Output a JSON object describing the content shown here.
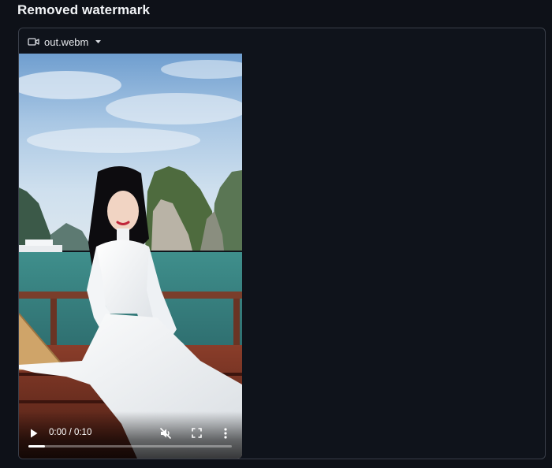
{
  "section": {
    "title": "Removed watermark"
  },
  "file_selector": {
    "filename": "out.webm",
    "icon": "video-camera-icon",
    "dropdown_icon": "caret-down-icon"
  },
  "player": {
    "time_display": "0:00 / 0:10",
    "progress": 0.08,
    "muted": true,
    "controls": [
      "play-icon",
      "muted-speaker-icon",
      "fullscreen-icon",
      "more-vert-icon"
    ]
  },
  "colors": {
    "background": "#0e1118",
    "panel_border": "#3a3f4a",
    "text": "#e6e8ec"
  }
}
